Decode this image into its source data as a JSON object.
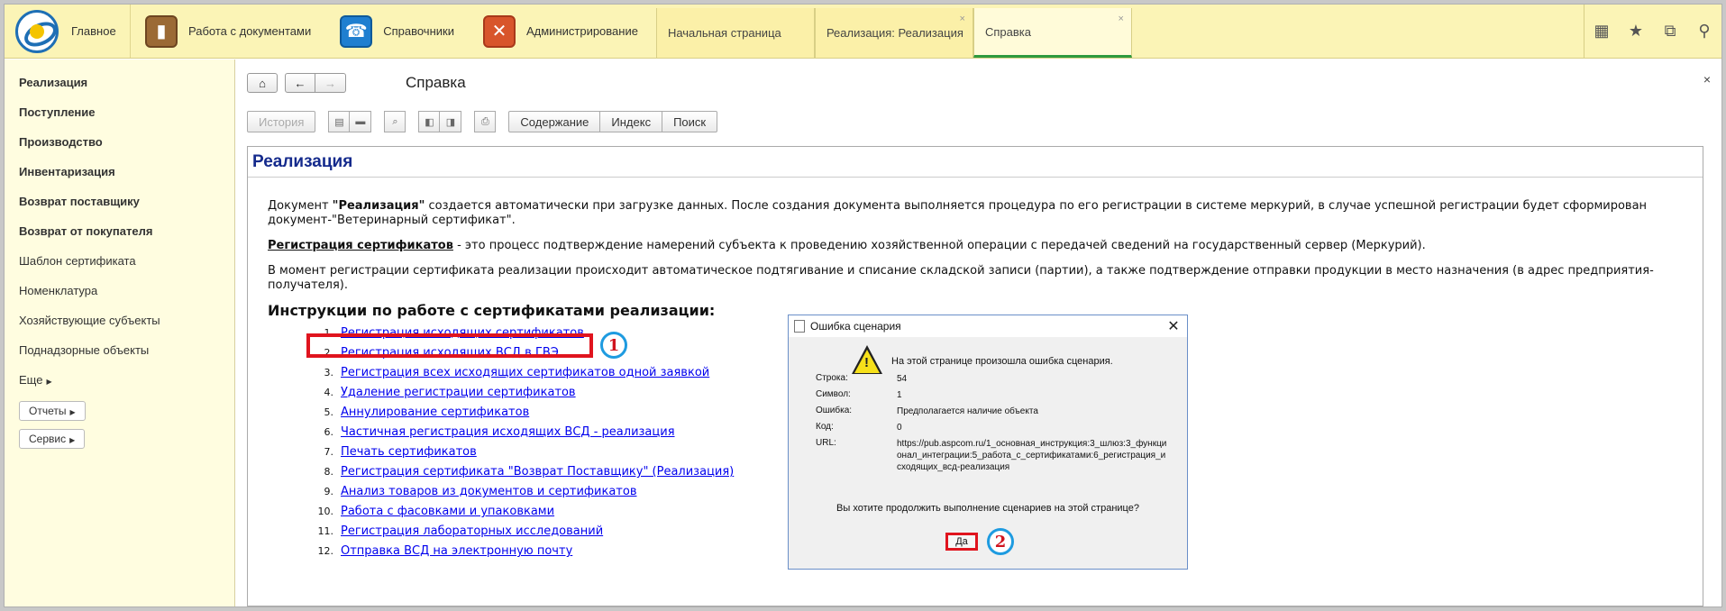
{
  "top": {
    "home_label": "Главное",
    "sections": [
      {
        "label": "Работа с документами",
        "icon": "briefcase-icon"
      },
      {
        "label": "Справочники",
        "icon": "address-book-icon"
      },
      {
        "label": "Администрирование",
        "icon": "tools-icon"
      }
    ],
    "tabs": [
      {
        "label": "Начальная страница",
        "closable": false
      },
      {
        "label": "Реализация: Реализация",
        "closable": true
      },
      {
        "label": "Справка",
        "closable": true,
        "active": true
      }
    ],
    "tab_close": "×",
    "right_icons": [
      "apps-grid-icon",
      "star-icon",
      "history-icon",
      "search-icon"
    ]
  },
  "sidebar": {
    "items": [
      {
        "label": "Реализация",
        "bold": true
      },
      {
        "label": "Поступление",
        "bold": true
      },
      {
        "label": "Производство",
        "bold": true
      },
      {
        "label": "Инвентаризация",
        "bold": true
      },
      {
        "label": "Возврат поставщику",
        "bold": true
      },
      {
        "label": "Возврат от покупателя",
        "bold": true
      },
      {
        "label": "Шаблон сертификата",
        "bold": false
      },
      {
        "label": "Номенклатура",
        "bold": false
      },
      {
        "label": "Хозяйствующие субъекты",
        "bold": false
      },
      {
        "label": "Поднадзорные объекты",
        "bold": false
      }
    ],
    "more_label": "Еще",
    "reports_label": "Отчеты",
    "service_label": "Сервис"
  },
  "main": {
    "title": "Справка",
    "close": "×",
    "toolbar": {
      "history": "История",
      "contents": "Содержание",
      "index": "Индекс",
      "search": "Поиск"
    },
    "help": {
      "heading": "Реализация",
      "p1_a": "Документ ",
      "p1_bold": "\"Реализация\"",
      "p1_b": " создается автоматически при загрузке данных. После создания документа выполняется процедура по его регистрации в системе меркурий, в случае успешной регистрации будет сформирован документ-\"Ветеринарный сертификат\".",
      "p2_bold": "Регистрация сертификатов",
      "p2_b": " - это процесс подтверждение намерений субъекта к проведению хозяйственной операции с передачей сведений на государственный сервер (Меркурий).",
      "p3": "В момент регистрации сертификата реализации происходит автоматическое подтягивание и списание складской записи (партии), а также подтверждение отправки продукции в место назначения (в адрес предприятия-получателя).",
      "instr_title": "Инструкции по работе с сертификатами реализации:",
      "list": [
        {
          "num": "1.",
          "text": "Регистрация исходящих сертификатов"
        },
        {
          "num": "2.",
          "text": "Регистрация исходящих ВСД в ГВЭ"
        },
        {
          "num": "3.",
          "text": "Регистрация всех исходящих сертификатов одной заявкой"
        },
        {
          "num": "4.",
          "text": "Удаление регистрации сертификатов"
        },
        {
          "num": "5.",
          "text": "Аннулирование сертификатов"
        },
        {
          "num": "6.",
          "text": "Частичная регистрация исходящих ВСД - реализация"
        },
        {
          "num": "7.",
          "text": "Печать сертификатов"
        },
        {
          "num": "8.",
          "text": "Регистрация сертификата \"Возврат Поставщику\" (Реализация)"
        },
        {
          "num": "9.",
          "text": "Анализ товаров из документов и сертификатов"
        },
        {
          "num": "10.",
          "text": "Работа с фасовками и упаковками"
        },
        {
          "num": "11.",
          "text": "Регистрация лабораторных исследований "
        },
        {
          "num": "12.",
          "text": "Отправка ВСД на электронную почту"
        }
      ]
    }
  },
  "annotations": {
    "badge1": "1",
    "badge2": "2"
  },
  "dialog": {
    "title": "Ошибка сценария",
    "close": "✕",
    "message": "На этой странице произошла ошибка сценария.",
    "fields": [
      {
        "key": "Строка:",
        "value": "54"
      },
      {
        "key": "Символ:",
        "value": "1"
      },
      {
        "key": "Ошибка:",
        "value": "Предполагается наличие объекта"
      },
      {
        "key": "Код:",
        "value": "0"
      },
      {
        "key": "URL:",
        "value": "https://pub.aspcom.ru/1_основная_инструкция:3_шлюз:3_функционал_интеграции:5_работа_с_сертификатами:6_регистрация_исходящих_всд-реализация"
      }
    ],
    "question": "Вы хотите продолжить выполнение сценариев на этой странице?",
    "yes": "Да"
  },
  "colors": {
    "topbar": "#fbf4b6",
    "sidebar": "#fffde0",
    "heading": "#142a8c",
    "link": "#0000ee",
    "highlight": "#e0141e",
    "badge_ring": "#1e9be0",
    "active_tab": "#2e9a3e"
  }
}
